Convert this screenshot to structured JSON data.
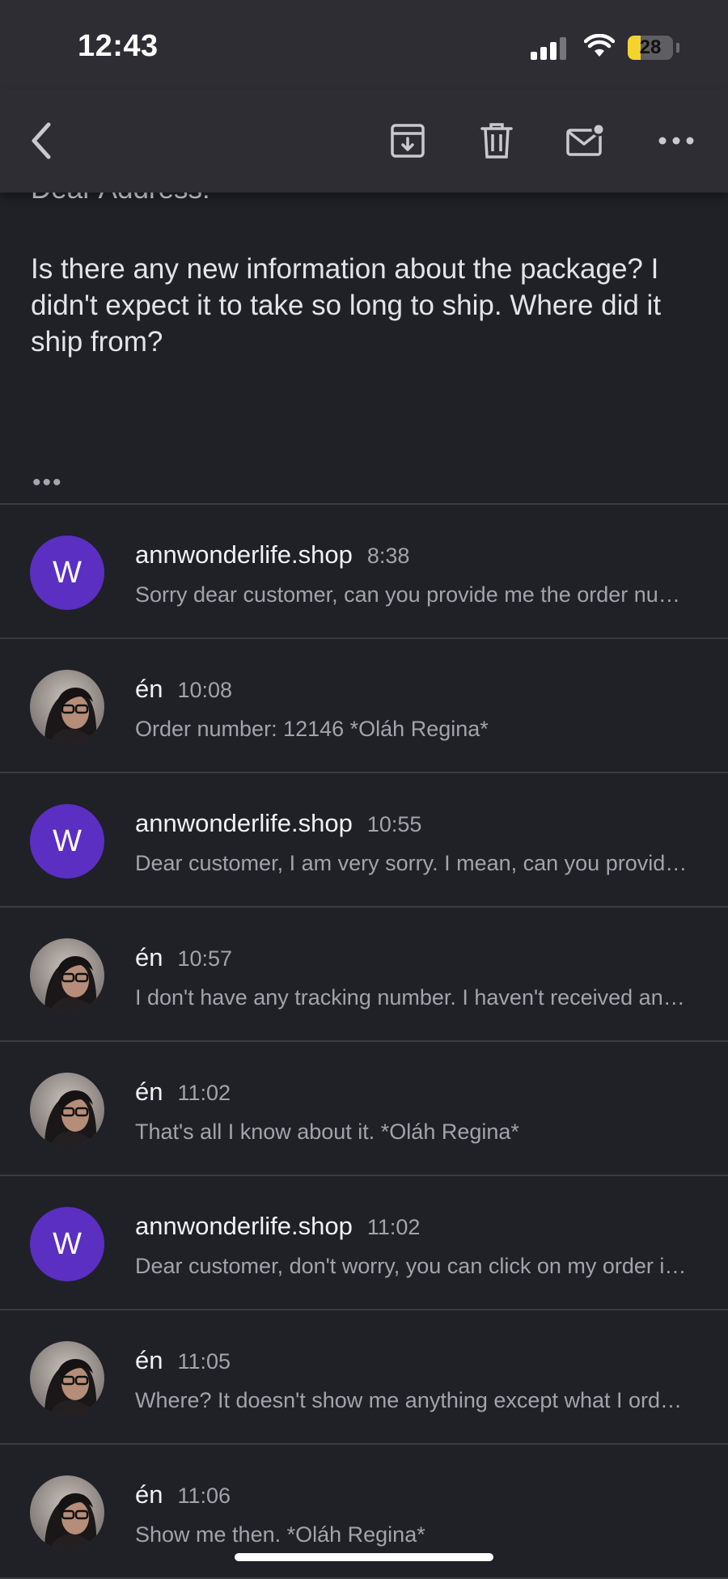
{
  "status_bar": {
    "time": "12:43",
    "battery": "28",
    "battery_level": 0.28
  },
  "toolbar": {
    "back_icon": "chevron-left-icon",
    "archive_icon": "archive-icon",
    "delete_icon": "trash-icon",
    "mark_unread_icon": "mail-unread-icon",
    "more_icon": "more-horizontal-icon"
  },
  "message": {
    "greeting": "Dear Address!",
    "body": "Is there any new information about the package? I didn't expect it to take so long to ship. Where did it ship from?",
    "ellipsis": "•••"
  },
  "thread": [
    {
      "sender": "annwonderlife.shop",
      "time": "8:38",
      "avatar_type": "letter",
      "avatar_letter": "W",
      "preview": "Sorry dear customer, can you provide me the order number"
    },
    {
      "sender": "én",
      "time": "10:08",
      "avatar_type": "photo",
      "preview": "Order number: 12146 *Oláh Regina*"
    },
    {
      "sender": "annwonderlife.shop",
      "time": "10:55",
      "avatar_type": "letter",
      "avatar_letter": "W",
      "preview": "Dear customer, I am very sorry. I mean, can you provide the tracking number"
    },
    {
      "sender": "én",
      "time": "10:57",
      "avatar_type": "photo",
      "preview": "I don't have any tracking number. I haven't received anything"
    },
    {
      "sender": "én",
      "time": "11:02",
      "avatar_type": "photo",
      "preview": "That's all I know about it. *Oláh Regina*"
    },
    {
      "sender": "annwonderlife.shop",
      "time": "11:02",
      "avatar_type": "letter",
      "avatar_letter": "W",
      "preview": "Dear customer, don't worry, you can click on my order in the store"
    },
    {
      "sender": "én",
      "time": "11:05",
      "avatar_type": "photo",
      "preview": "Where? It doesn't show me anything except what I ordered"
    },
    {
      "sender": "én",
      "time": "11:06",
      "avatar_type": "photo",
      "preview": "Show me then. *Oláh Regina*"
    }
  ],
  "colors": {
    "background": "#202027",
    "toolbar": "#2d2d33",
    "avatar_purple": "#5a2fc2",
    "battery_yellow": "#f3d42c"
  }
}
